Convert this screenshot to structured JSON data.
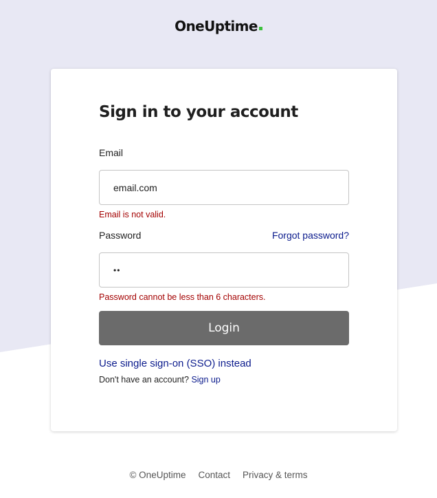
{
  "brand": {
    "name": "OneUptime",
    "accent_color": "#3ec13e",
    "background_band_color": "#e8e8f4"
  },
  "login_card": {
    "heading": "Sign in to your account",
    "email": {
      "label": "Email",
      "value": "email.com",
      "error": "Email is not valid."
    },
    "password": {
      "label": "Password",
      "value": "••",
      "forgot_link": "Forgot password?",
      "error": "Password cannot be less than 6 characters."
    },
    "login_button": "Login",
    "login_button_color": "#6b6b6b",
    "sso_link": "Use single sign-on (SSO) instead",
    "signup_prompt": "Don't have an account?",
    "signup_link": "Sign up",
    "link_color": "#0a1a8c",
    "error_color": "#a30000"
  },
  "footer": {
    "copyright": "© OneUptime",
    "contact": "Contact",
    "privacy": "Privacy & terms"
  }
}
